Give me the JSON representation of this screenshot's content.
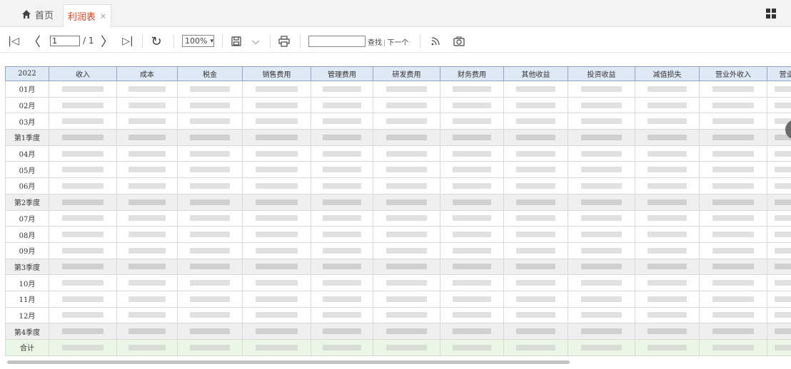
{
  "tabs": {
    "home_label": "首页",
    "active_label": "利润表",
    "close_glyph": "×"
  },
  "toolbar": {
    "first_glyph": "|◁",
    "prev_glyph": "〈",
    "page_value": "1",
    "page_total": "/ 1",
    "next_glyph": "〉",
    "last_glyph": "▷|",
    "refresh_glyph": "↻",
    "zoom_value": "100%",
    "save_glyph": "🖫",
    "dropdown_glyph": "⌵",
    "print_glyph": "⎙",
    "find_value": "",
    "find_label": "查找",
    "find_next_label": "下一个"
  },
  "table": {
    "headers": [
      "2022",
      "收入",
      "成本",
      "税金",
      "销售费用",
      "管理费用",
      "研发费用",
      "财务费用",
      "其他收益",
      "投资收益",
      "减值损失",
      "营业外收入",
      "营业"
    ],
    "rows": [
      {
        "label": "01月",
        "type": "month"
      },
      {
        "label": "02月",
        "type": "month"
      },
      {
        "label": "03月",
        "type": "month"
      },
      {
        "label": "第1季度",
        "type": "quarter"
      },
      {
        "label": "04月",
        "type": "month"
      },
      {
        "label": "05月",
        "type": "month"
      },
      {
        "label": "06月",
        "type": "month"
      },
      {
        "label": "第2季度",
        "type": "quarter"
      },
      {
        "label": "07月",
        "type": "month"
      },
      {
        "label": "08月",
        "type": "month"
      },
      {
        "label": "09月",
        "type": "month"
      },
      {
        "label": "第3季度",
        "type": "quarter"
      },
      {
        "label": "10月",
        "type": "month"
      },
      {
        "label": "11月",
        "type": "month"
      },
      {
        "label": "12月",
        "type": "month"
      },
      {
        "label": "第4季度",
        "type": "quarter"
      },
      {
        "label": "合计",
        "type": "total"
      }
    ]
  }
}
